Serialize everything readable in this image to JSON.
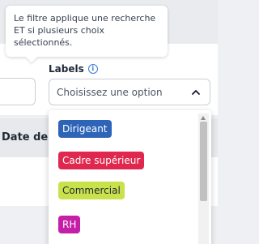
{
  "tooltip": {
    "text": "Le filtre applique une recherche ET si plusieurs choix sélectionnés."
  },
  "labels_filter": {
    "title": "Labels",
    "info_icon": "info-icon",
    "placeholder": "Choisissez une option",
    "chevron_icon": "chevron-up-icon"
  },
  "table": {
    "date_header": "Date de m"
  },
  "dropdown": {
    "options": [
      {
        "label": "Dirigeant",
        "bg": "#2d64b8",
        "color": "#ffffff"
      },
      {
        "label": "Cadre supérieur",
        "bg": "#e0284f",
        "color": "#ffffff"
      },
      {
        "label": "Commercial",
        "bg": "#c9e14a",
        "color": "#1f2937"
      },
      {
        "label": "RH",
        "bg": "#c41fa6",
        "color": "#ffffff"
      }
    ]
  }
}
